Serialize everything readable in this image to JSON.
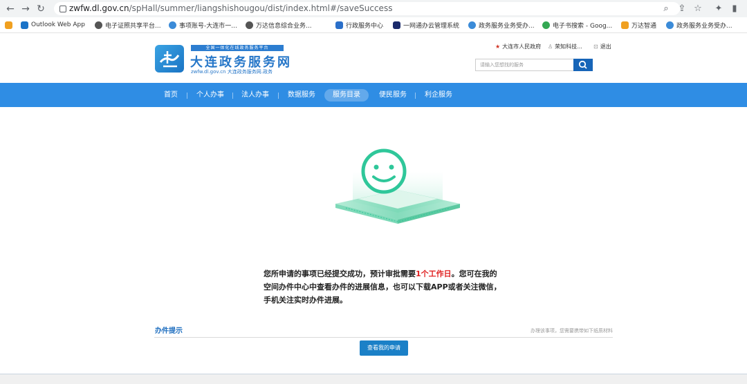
{
  "browser": {
    "url_domain": "zwfw.dl.gov.cn",
    "url_path": "/spHall/summer/liangshishougou/dist/index.html#/saveSuccess",
    "bookmarks": [
      {
        "label": "",
        "icon": "shield-app-icon",
        "color": "#f0a020"
      },
      {
        "label": "Outlook Web App",
        "icon": "outlook-icon",
        "color": "#1a73c7"
      },
      {
        "label": "电子证照共享平台...",
        "icon": "globe-icon",
        "color": "#555555"
      },
      {
        "label": "事项账号-大连市一...",
        "icon": "swirl-icon",
        "color": "#3b8bd8"
      },
      {
        "label": "万达信息综合业务...",
        "icon": "globe-icon",
        "color": "#555555"
      },
      {
        "label": "行政服务中心",
        "icon": "wd-icon",
        "color": "#2a6fc9"
      },
      {
        "label": "一网通办云管理系统",
        "icon": "cloud-icon",
        "color": "#1a2a6a"
      },
      {
        "label": "政务服务业务受办...",
        "icon": "swirl-icon",
        "color": "#3b8bd8"
      },
      {
        "label": "电子书搜索 - Goog...",
        "icon": "google-icon",
        "color": "#34a853"
      },
      {
        "label": "万达智通",
        "icon": "shield-app-icon",
        "color": "#f0a020"
      },
      {
        "label": "政务服务业务受办...",
        "icon": "swirl-icon",
        "color": "#3b8bd8"
      }
    ]
  },
  "header": {
    "logo_sub": "全国一体化在线政务服务平台",
    "logo_title": "大连政务服务网",
    "logo_domain": "zwfw.dl.gov.cn  大连政务服务网.政务",
    "gov_link": "大连市人民政府",
    "user_link": "荣知科技...",
    "logout_link": "退出",
    "search_placeholder": "请输入您想找的服务"
  },
  "nav": {
    "items": [
      {
        "label": "首页"
      },
      {
        "label": "个人办事"
      },
      {
        "label": "法人办事"
      },
      {
        "label": "数据服务"
      },
      {
        "label": "服务目录"
      },
      {
        "label": "便民服务"
      },
      {
        "label": "利企服务"
      }
    ],
    "active": "服务目录"
  },
  "content": {
    "message_part1": "您所申请的事项已经提交成功，预计审批需要",
    "message_highlight": "1个工作日",
    "message_part2": "。您可在我的空间办件中心中查看办件的进展信息，也可以下载APP或者关注微信，手机关注实时办件进展。",
    "tips_title": "办件提示",
    "tips_note": "办理该事项，您需要携带如下纸质材料",
    "view_button": "查看我的申请"
  },
  "colors": {
    "nav_blue": "#2f8de4",
    "brand_blue": "#2576c8",
    "highlight_red": "#e02020",
    "success_green": "#2fc79a"
  }
}
